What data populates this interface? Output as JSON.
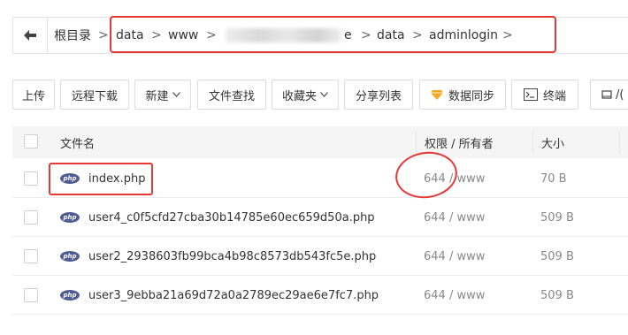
{
  "pathbar": {
    "crumbs": [
      "根目录",
      "data",
      "www",
      "e",
      "data",
      "adminlogin"
    ],
    "separator": ">"
  },
  "toolbar": {
    "upload": "上传",
    "remote_download": "远程下载",
    "new": "新建",
    "file_search": "文件查找",
    "favorites": "收藏夹",
    "share_list": "分享列表",
    "data_sync": "数据同步",
    "terminal": "终端",
    "partial": "/("
  },
  "table": {
    "headers": {
      "name": "文件名",
      "permission": "权限 / 所有者",
      "size": "大小"
    },
    "rows": [
      {
        "name": "index.php",
        "perm": "644",
        "owner": "www",
        "size": "70 B"
      },
      {
        "name": "user4_c0f5cfd27cba30b14785e60ec659d50a.php",
        "perm": "644",
        "owner": "www",
        "size": "509 B"
      },
      {
        "name": "user2_2938603fb99bca4b98c8573db543fc5e.php",
        "perm": "644",
        "owner": "www",
        "size": "509 B"
      },
      {
        "name": "user3_9ebba21a69d72a0a2789ec29ae6e7fc7.php",
        "perm": "644",
        "owner": "www",
        "size": "509 B"
      }
    ],
    "perm_sep": " / ",
    "icon_text": "php"
  },
  "colors": {
    "annotation": "#e53935",
    "php_icon": "#4f5b93",
    "sync_icon": "#f5a623"
  }
}
